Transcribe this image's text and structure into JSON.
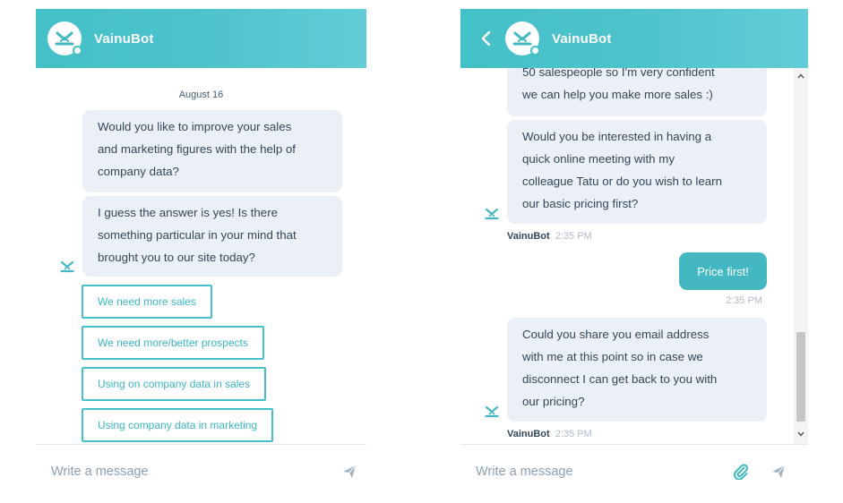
{
  "left": {
    "header": {
      "bot_name": "VainuBot"
    },
    "date": "August 16",
    "messages": [
      {
        "lines": [
          "Would you like to improve your sales",
          "and marketing figures with the help of",
          "company data?"
        ]
      },
      {
        "lines": [
          "I guess the answer is yes! Is there",
          "something particular in your mind that",
          "brought you to our site today?"
        ]
      }
    ],
    "quick_replies": [
      "We need more sales",
      "We need more/better prospects",
      "Using on company data in sales",
      "Using company data in marketing"
    ],
    "composer": {
      "placeholder": "Write a message"
    }
  },
  "right": {
    "header": {
      "bot_name": "VainuBot"
    },
    "messages": [
      {
        "lines": [
          "50 salespeople so I'm very confident",
          "we can help you make more sales :)"
        ]
      },
      {
        "lines": [
          "Would you be interested in having a",
          "quick online meeting with my",
          "colleague Tatu or do you wish to learn",
          "our basic pricing first?"
        ]
      },
      {
        "lines": [
          "Could you share you email address",
          "with me at this point so in case we",
          "disconnect I can get back to you with",
          "our pricing?"
        ]
      }
    ],
    "meta_1": {
      "name": "VainuBot",
      "time": "2:35 PM"
    },
    "user_reply": {
      "text": "Price first!",
      "time": "2:35 PM"
    },
    "meta_2": {
      "name": "VainuBot",
      "time": "2:35 PM"
    },
    "composer": {
      "placeholder": "Write a message"
    }
  },
  "colors": {
    "header": "#44c0c8",
    "accent": "#44b8c2",
    "bubble": "#eaf0f6"
  },
  "icons": [
    "vainu-logo-icon",
    "back-chevron-icon",
    "send-icon",
    "paperclip-icon",
    "scroll-up-icon",
    "scroll-down-icon"
  ]
}
